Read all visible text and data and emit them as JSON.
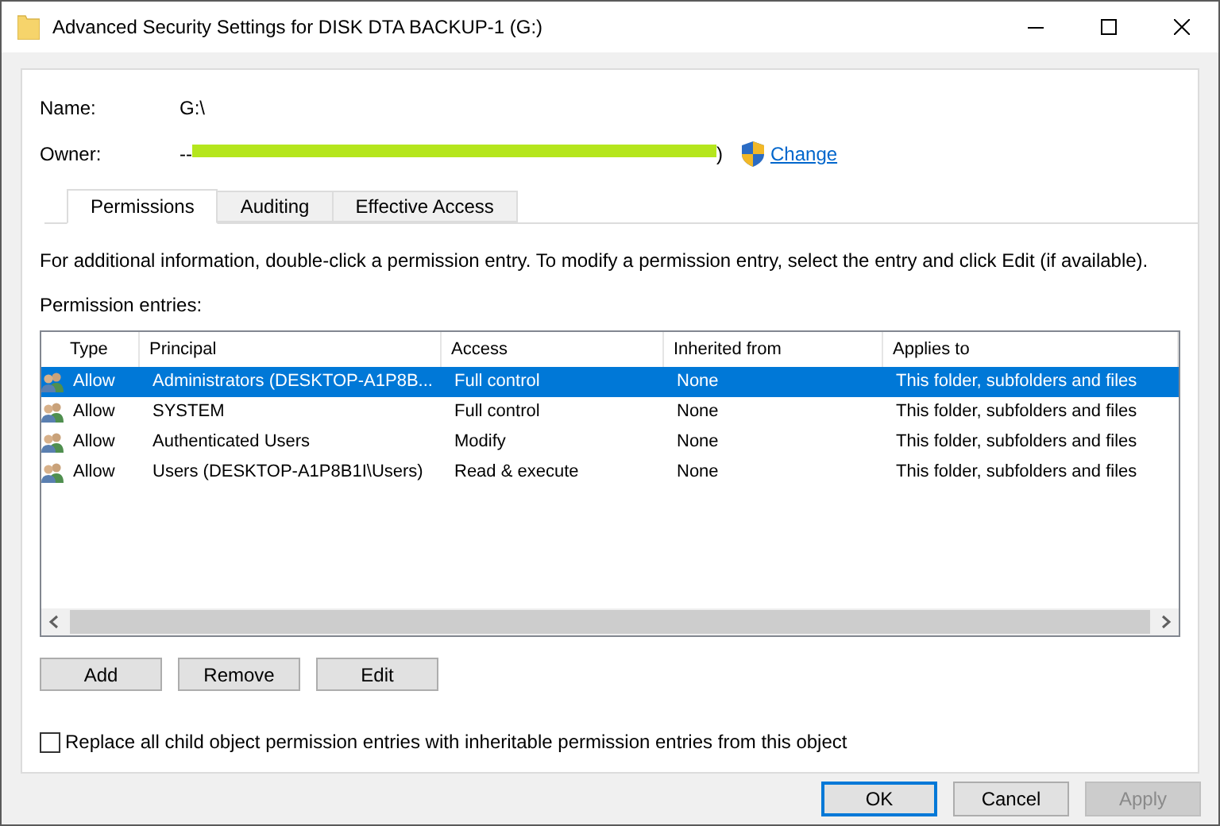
{
  "window": {
    "title": "Advanced Security Settings for DISK DTA BACKUP-1 (G:)"
  },
  "name": {
    "label": "Name:",
    "value": "G:\\"
  },
  "owner": {
    "label": "Owner:",
    "value_start": "--",
    "value_end": ")",
    "redacted": true,
    "change_link": "Change"
  },
  "tabs": [
    {
      "label": "Permissions",
      "selected": true
    },
    {
      "label": "Auditing",
      "selected": false
    },
    {
      "label": "Effective Access",
      "selected": false
    }
  ],
  "info": "For additional information, double-click a permission entry. To modify a permission entry, select the entry and click Edit (if available).",
  "entries_label": "Permission entries:",
  "table": {
    "columns": [
      "Type",
      "Principal",
      "Access",
      "Inherited from",
      "Applies to"
    ],
    "rows": [
      {
        "cells": [
          "Allow",
          "Administrators (DESKTOP-A1P8B...",
          "Full control",
          "None",
          "This folder, subfolders and files"
        ],
        "selected": true
      },
      {
        "cells": [
          "Allow",
          "SYSTEM",
          "Full control",
          "None",
          "This folder, subfolders and files"
        ],
        "selected": false
      },
      {
        "cells": [
          "Allow",
          "Authenticated Users",
          "Modify",
          "None",
          "This folder, subfolders and files"
        ],
        "selected": false
      },
      {
        "cells": [
          "Allow",
          "Users (DESKTOP-A1P8B1I\\Users)",
          "Read & execute",
          "None",
          "This folder, subfolders and files"
        ],
        "selected": false
      }
    ]
  },
  "action_buttons": [
    "Add",
    "Remove",
    "Edit"
  ],
  "replace_checkbox": {
    "label": "Replace all child object permission entries with inheritable permission entries from this object",
    "checked": false
  },
  "footer_buttons": [
    {
      "label": "OK",
      "default": true,
      "disabled": false
    },
    {
      "label": "Cancel",
      "default": false,
      "disabled": false
    },
    {
      "label": "Apply",
      "default": false,
      "disabled": true
    }
  ]
}
